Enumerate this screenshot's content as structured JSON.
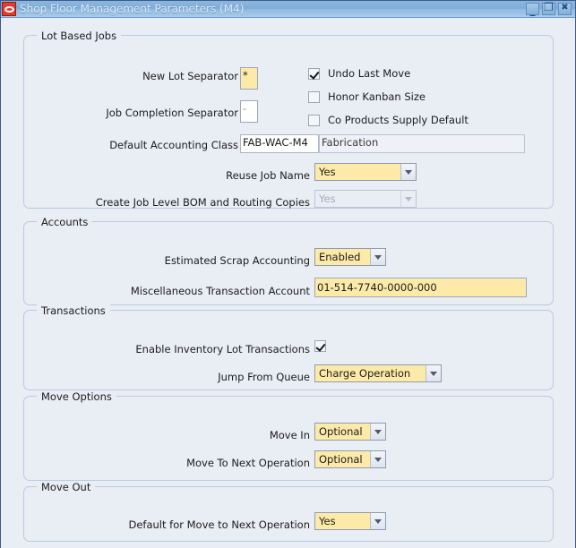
{
  "window": {
    "title": "Shop Floor Management Parameters (M4)",
    "icon": "oracle-logo-icon",
    "buttons": {
      "minimize": "_",
      "maximize": "❐",
      "close": "✖"
    }
  },
  "groups": {
    "lot_based_jobs": {
      "legend": "Lot Based Jobs",
      "fields": {
        "new_lot_separator": {
          "label": "New Lot Separator",
          "value": "*"
        },
        "job_completion_separator": {
          "label": "Job Completion Separator",
          "value": "-"
        },
        "default_accounting_class": {
          "label": "Default Accounting Class",
          "value": "FAB-WAC-M4",
          "description": "Fabrication"
        },
        "reuse_job_name": {
          "label": "Reuse Job Name",
          "value": "Yes"
        },
        "create_job_level_bom": {
          "label": "Create Job Level BOM and Routing Copies",
          "value": "Yes"
        }
      },
      "checkboxes": [
        {
          "label": "Undo Last Move",
          "checked": true
        },
        {
          "label": "Honor Kanban Size",
          "checked": false
        },
        {
          "label": "Co Products Supply Default",
          "checked": false
        }
      ]
    },
    "accounts": {
      "legend": "Accounts",
      "fields": {
        "estimated_scrap_accounting": {
          "label": "Estimated Scrap Accounting",
          "value": "Enabled"
        },
        "misc_transaction_account": {
          "label": "Miscellaneous Transaction Account",
          "value": "01-514-7740-0000-000"
        }
      }
    },
    "transactions": {
      "legend": "Transactions",
      "fields": {
        "enable_inventory_lot_transactions": {
          "label": "Enable Inventory Lot Transactions",
          "checked": true
        },
        "jump_from_queue": {
          "label": "Jump From Queue",
          "value": "Charge Operation"
        }
      }
    },
    "move_options": {
      "legend": "Move Options",
      "fields": {
        "move_in": {
          "label": "Move In",
          "value": "Optional"
        },
        "move_to_next_operation": {
          "label": "Move To Next Operation",
          "value": "Optional"
        }
      }
    },
    "move_out": {
      "legend": "Move Out",
      "fields": {
        "default_for_move_to_next_operation": {
          "label": "Default for Move to Next Operation",
          "value": "Yes"
        }
      }
    }
  },
  "colors": {
    "window_background": "#e9edf4",
    "titlebar": "#8db6dd",
    "field_highlight": "#fdeaa8",
    "group_border": "#b9cbe3",
    "icon_red": "#e03c2e"
  }
}
